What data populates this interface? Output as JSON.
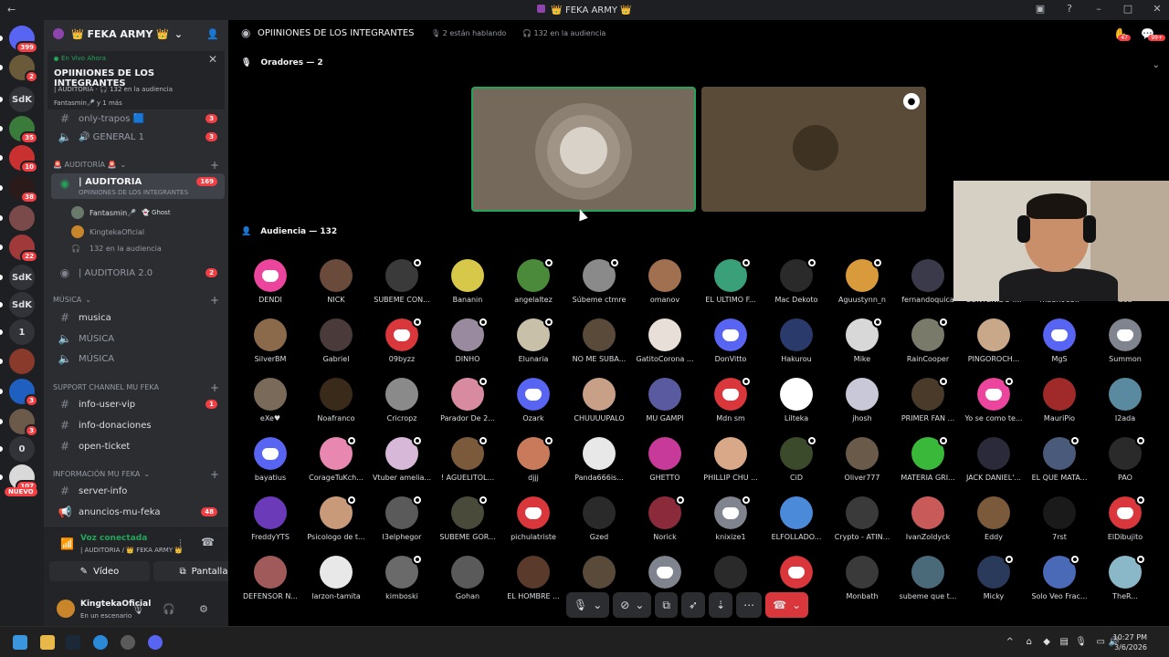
{
  "window": {
    "title": "👑 FEKA ARMY 👑"
  },
  "servers": [
    {
      "label": "",
      "badge": "399",
      "color": "#5865f2"
    },
    {
      "label": "",
      "badge": "2",
      "color": "#6b5a3a"
    },
    {
      "label": "SdK",
      "badge": "",
      "color": "#313338"
    },
    {
      "label": "",
      "badge": "35",
      "color": "#3a7a3a"
    },
    {
      "label": "",
      "badge": "10",
      "color": "#c93030"
    },
    {
      "label": "",
      "badge": "38",
      "color": "#2a1a1a"
    },
    {
      "label": "",
      "badge": "",
      "color": "#7a4a4a"
    },
    {
      "label": "",
      "badge": "22",
      "color": "#a03a3a"
    },
    {
      "label": "SdK",
      "badge": "",
      "color": "#313338"
    },
    {
      "label": "SdK",
      "badge": "",
      "color": "#313338"
    },
    {
      "label": "1",
      "badge": "",
      "color": "#313338"
    },
    {
      "label": "",
      "badge": "",
      "color": "#8a3a2a"
    },
    {
      "label": "",
      "badge": "3",
      "color": "#1e5fbf"
    },
    {
      "label": "",
      "badge": "3",
      "color": "#6b5a4a"
    },
    {
      "label": "0",
      "badge": "",
      "color": "#313338"
    },
    {
      "label": "",
      "badge": "107",
      "color": "#d9d9d9"
    }
  ],
  "nuevo_label": "NUEVO",
  "sidebar": {
    "guild_name": "👑 FEKA ARMY 👑",
    "live": {
      "label": "En Vivo Ahora",
      "channel": "OPIINIONES DE LOS INTEGRANTES",
      "meta": "| AUDITORIA · 🎧 132 en la audiencia",
      "who": "Fantasmin🎤 y 1 más"
    },
    "channels_top": [
      {
        "name": "only-trapos 🟦",
        "badge": "3"
      },
      {
        "name": "🔊 GENERAL 1",
        "badge": "3"
      }
    ],
    "cat_auditoria": "🚨 AUDITORÍA 🚨",
    "auditoria_active": {
      "name": "| AUDITORIA",
      "sub": "OPIINIONES DE LOS INTEGRANTES",
      "badge": "169"
    },
    "stage_users": [
      {
        "name": "Fantasmin🎤",
        "tag": "👻 Ghost"
      },
      {
        "name": "KingtekaOficial",
        "tag": ""
      },
      {
        "name": "132 en la audiencia",
        "tag": ""
      }
    ],
    "auditoria2": {
      "name": "| AUDITORIA 2.0",
      "badge": "2"
    },
    "cat_musica": "MÚSICA",
    "musica_channels": [
      "musica",
      "MÚSICA",
      "MÚSICA"
    ],
    "cat_support": "SUPPORT CHANNEL MU FEKA",
    "support_channels": [
      {
        "name": "info-user-vip",
        "badge": "1"
      },
      {
        "name": "info-donaciones",
        "badge": ""
      },
      {
        "name": "open-ticket",
        "badge": ""
      }
    ],
    "cat_info": "INFORMACIÓN MU FEKA",
    "info_channels": [
      {
        "name": "server-info",
        "badge": ""
      },
      {
        "name": "anuncios-mu-feka",
        "badge": "48"
      }
    ],
    "voice": {
      "status": "Voz conectada",
      "sub": "| AUDITORIA / 👑 FEKA ARMY 👑",
      "video_label": "Vídeo",
      "screen_label": "Pantalla"
    },
    "user": {
      "name": "KingtekaOficial",
      "status": "En un escenario"
    }
  },
  "main": {
    "channel_title": "OPIINIONES DE LOS INTEGRANTES",
    "speaking": "2 están hablando",
    "audience_count": "132 en la audiencia",
    "top_badges": [
      "47",
      "99+"
    ],
    "speakers_header": "Oradores — 2",
    "audience_header": "Audiencia — 132"
  },
  "audience": [
    {
      "name": "DENDI",
      "kind": "discord",
      "color": "#eb459e",
      "badge": false
    },
    {
      "name": "NICK",
      "kind": "photo",
      "color": "#6a4a3a",
      "badge": false
    },
    {
      "name": "SUBEME CON...",
      "kind": "photo",
      "color": "#3a3a3a",
      "badge": true
    },
    {
      "name": "Bananin",
      "kind": "photo",
      "color": "#d8c84a",
      "badge": false
    },
    {
      "name": "angelaltez",
      "kind": "photo",
      "color": "#4a8a3a",
      "badge": true
    },
    {
      "name": "Súbeme ctmre",
      "kind": "photo",
      "color": "#8a8a8a",
      "badge": true
    },
    {
      "name": "omanov",
      "kind": "photo",
      "color": "#a07050",
      "badge": false
    },
    {
      "name": "EL ULTIMO F...",
      "kind": "photo",
      "color": "#3aa07a",
      "badge": true
    },
    {
      "name": "Mac Dekoto",
      "kind": "photo",
      "color": "#2a2a2a",
      "badge": true
    },
    {
      "name": "Aguustynn_n",
      "kind": "photo",
      "color": "#d89a3a",
      "badge": true
    },
    {
      "name": "fernandoquica",
      "kind": "photo",
      "color": "#3a3a4a",
      "badge": false
    },
    {
      "name": "CONTENIDO I...",
      "kind": "photo",
      "color": "#9a9a9a",
      "badge": false
    },
    {
      "name": "mauri985II",
      "kind": "photo",
      "color": "#6a6a6a",
      "badge": false
    },
    {
      "name": "aea",
      "kind": "photo",
      "color": "#5a5a5a",
      "badge": false
    },
    {
      "name": "SilverBM",
      "kind": "photo",
      "color": "#8a6a4a",
      "badge": false
    },
    {
      "name": "Gabriel",
      "kind": "photo",
      "color": "#4a3a3a",
      "badge": false
    },
    {
      "name": "09byzz",
      "kind": "discord",
      "color": "#da373c",
      "badge": true
    },
    {
      "name": "DINHO",
      "kind": "photo",
      "color": "#9a8aa0",
      "badge": true
    },
    {
      "name": "Elunaria",
      "kind": "photo",
      "color": "#c8c0a8",
      "badge": true
    },
    {
      "name": "NO ME SUBA...",
      "kind": "photo",
      "color": "#5a4a3a",
      "badge": false
    },
    {
      "name": "GatitoCorona ...",
      "kind": "photo",
      "color": "#e8e0d8",
      "badge": false
    },
    {
      "name": "DonVitto",
      "kind": "discord",
      "color": "#5865f2",
      "badge": false
    },
    {
      "name": "Hakurou",
      "kind": "photo",
      "color": "#2a3a6a",
      "badge": false
    },
    {
      "name": "Mike",
      "kind": "photo",
      "color": "#d8d8d8",
      "badge": true
    },
    {
      "name": "RainCooper",
      "kind": "photo",
      "color": "#7a7a6a",
      "badge": true
    },
    {
      "name": "PINGOROCH...",
      "kind": "photo",
      "color": "#c8a888",
      "badge": false
    },
    {
      "name": "MgS",
      "kind": "discord",
      "color": "#5865f2",
      "badge": false
    },
    {
      "name": "Summon",
      "kind": "discord",
      "color": "#80848e",
      "badge": false
    },
    {
      "name": "eXe♥",
      "kind": "photo",
      "color": "#7a6a5a",
      "badge": false
    },
    {
      "name": "Noafranco",
      "kind": "photo",
      "color": "#3a2a1a",
      "badge": false
    },
    {
      "name": "Cricropz",
      "kind": "photo",
      "color": "#8a8a8a",
      "badge": false
    },
    {
      "name": "Parador De 2...",
      "kind": "photo",
      "color": "#d88aa0",
      "badge": true
    },
    {
      "name": "Ozark",
      "kind": "discord",
      "color": "#5865f2",
      "badge": false
    },
    {
      "name": "CHUUUUPALO",
      "kind": "photo",
      "color": "#c8a088",
      "badge": false
    },
    {
      "name": "MU GAMPI",
      "kind": "photo",
      "color": "#5a5aa0",
      "badge": false
    },
    {
      "name": "Mdn sm",
      "kind": "discord",
      "color": "#da373c",
      "badge": true
    },
    {
      "name": "Lilteka",
      "kind": "photo",
      "color": "#ffffff",
      "badge": false
    },
    {
      "name": "jhosh",
      "kind": "photo",
      "color": "#c8c8d8",
      "badge": false
    },
    {
      "name": "PRIMER FAN ...",
      "kind": "photo",
      "color": "#4a3a2a",
      "badge": true
    },
    {
      "name": "Yo se como te...",
      "kind": "discord",
      "color": "#eb459e",
      "badge": true
    },
    {
      "name": "MauriPio",
      "kind": "photo",
      "color": "#a02a2a",
      "badge": false
    },
    {
      "name": "I2ada",
      "kind": "photo",
      "color": "#5a8aa0",
      "badge": false
    },
    {
      "name": "bayatius",
      "kind": "discord",
      "color": "#5865f2",
      "badge": false
    },
    {
      "name": "CorageTuKch...",
      "kind": "photo",
      "color": "#e888b0",
      "badge": true
    },
    {
      "name": "Vtuber amelia...",
      "kind": "photo",
      "color": "#d8b8d8",
      "badge": true
    },
    {
      "name": "! AGUELITOL...",
      "kind": "photo",
      "color": "#7a5a3a",
      "badge": true
    },
    {
      "name": "djjj",
      "kind": "photo",
      "color": "#c87a5a",
      "badge": true
    },
    {
      "name": "Panda666is...",
      "kind": "photo",
      "color": "#e8e8e8",
      "badge": false
    },
    {
      "name": "GHETTO",
      "kind": "photo",
      "color": "#c83a9a",
      "badge": false
    },
    {
      "name": "PHILLIP CHU ...",
      "kind": "photo",
      "color": "#d8a888",
      "badge": false
    },
    {
      "name": "CiD",
      "kind": "photo",
      "color": "#3a4a2a",
      "badge": true
    },
    {
      "name": "Oliver777",
      "kind": "photo",
      "color": "#6a5a4a",
      "badge": false
    },
    {
      "name": "MATERIA GRI...",
      "kind": "photo",
      "color": "#3ab83a",
      "badge": true
    },
    {
      "name": "JACK DANIEL'...",
      "kind": "photo",
      "color": "#2a2a3a",
      "badge": false
    },
    {
      "name": "EL QUE MATA...",
      "kind": "photo",
      "color": "#4a5a7a",
      "badge": true
    },
    {
      "name": "PAO",
      "kind": "photo",
      "color": "#2a2a2a",
      "badge": true
    },
    {
      "name": "FreddyYTS",
      "kind": "photo",
      "color": "#6a3ab8",
      "badge": false
    },
    {
      "name": "Psicologo de t...",
      "kind": "photo",
      "color": "#c89a7a",
      "badge": true
    },
    {
      "name": "I3elphegor",
      "kind": "photo",
      "color": "#5a5a5a",
      "badge": true
    },
    {
      "name": "SUBEME GOR...",
      "kind": "photo",
      "color": "#4a4a3a",
      "badge": true
    },
    {
      "name": "pichulatriste",
      "kind": "discord",
      "color": "#da373c",
      "badge": false
    },
    {
      "name": "Gzed",
      "kind": "photo",
      "color": "#2a2a2a",
      "badge": false
    },
    {
      "name": "Norick",
      "kind": "photo",
      "color": "#8a2a3a",
      "badge": true
    },
    {
      "name": "knixize1",
      "kind": "discord",
      "color": "#80848e",
      "badge": true
    },
    {
      "name": "ELFOLLADO...",
      "kind": "photo",
      "color": "#4a8ad8",
      "badge": false
    },
    {
      "name": "Crypto - ATIN...",
      "kind": "photo",
      "color": "#3a3a3a",
      "badge": false
    },
    {
      "name": "IvanZoldyck",
      "kind": "photo",
      "color": "#c85a5a",
      "badge": false
    },
    {
      "name": "Eddy",
      "kind": "photo",
      "color": "#7a5a3a",
      "badge": false
    },
    {
      "name": "7rst",
      "kind": "photo",
      "color": "#1a1a1a",
      "badge": false
    },
    {
      "name": "ElDibujito",
      "kind": "discord",
      "color": "#da373c",
      "badge": true
    },
    {
      "name": "DEFENSOR N...",
      "kind": "photo",
      "color": "#a05a5a",
      "badge": false
    },
    {
      "name": "larzon-tamita",
      "kind": "photo",
      "color": "#e8e8e8",
      "badge": false
    },
    {
      "name": "kimboski",
      "kind": "photo",
      "color": "#6a6a6a",
      "badge": true
    },
    {
      "name": "Gohan",
      "kind": "photo",
      "color": "#5a5a5a",
      "badge": false
    },
    {
      "name": "EL HOMBRE ...",
      "kind": "photo",
      "color": "#5a3a2a",
      "badge": false
    },
    {
      "name": "",
      "kind": "photo",
      "color": "#5a4a3a",
      "badge": false
    },
    {
      "name": "",
      "kind": "discord",
      "color": "#80848e",
      "badge": false
    },
    {
      "name": "",
      "kind": "photo",
      "color": "#2a2a2a",
      "badge": false
    },
    {
      "name": "",
      "kind": "discord",
      "color": "#da373c",
      "badge": false
    },
    {
      "name": "Monbath",
      "kind": "photo",
      "color": "#3a3a3a",
      "badge": false
    },
    {
      "name": "subeme que t...",
      "kind": "photo",
      "color": "#4a6a7a",
      "badge": false
    },
    {
      "name": "Micky",
      "kind": "photo",
      "color": "#2a3a5a",
      "badge": true
    },
    {
      "name": "Solo Veo Frac...",
      "kind": "photo",
      "color": "#4a6ab8",
      "badge": true
    },
    {
      "name": "TheR...",
      "kind": "photo",
      "color": "#8ab8c8",
      "badge": true
    }
  ],
  "taskbar": {
    "time": "10:27 PM",
    "date": "3/6/2026"
  }
}
